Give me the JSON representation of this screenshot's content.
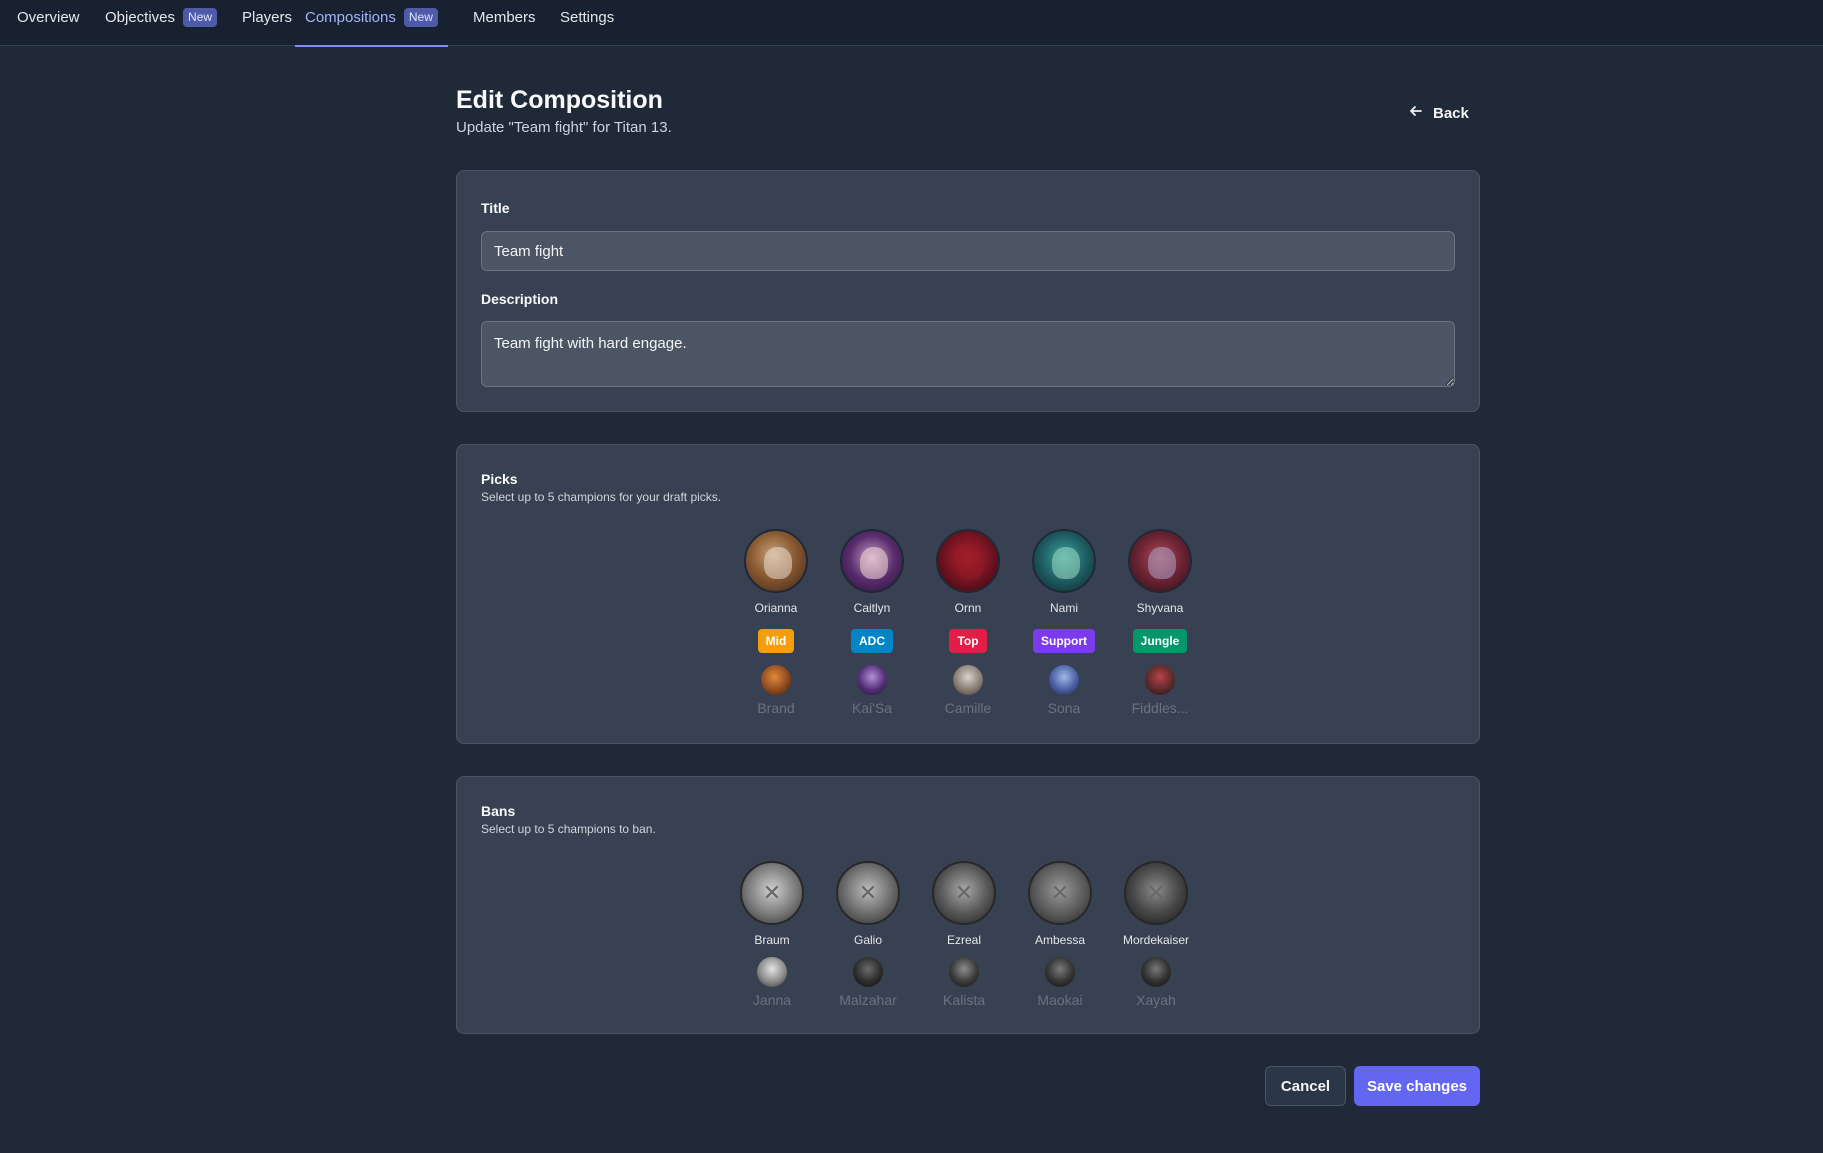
{
  "nav": {
    "tabs": [
      {
        "label": "Overview"
      },
      {
        "label": "Objectives",
        "badge": "New"
      },
      {
        "label": "Players"
      },
      {
        "label": "Compositions",
        "badge": "New"
      },
      {
        "label": "Members"
      },
      {
        "label": "Settings"
      }
    ],
    "active_tab": "Compositions"
  },
  "header": {
    "title": "Edit Composition",
    "subtitle": "Update \"Team fight\" for Titan 13.",
    "back_label": "Back"
  },
  "form": {
    "title_label": "Title",
    "title_value": "Team fight",
    "description_label": "Description",
    "description_value": "Team fight with hard engage."
  },
  "picks": {
    "title": "Picks",
    "subtitle": "Select up to 5 champions for your draft picks.",
    "items": [
      {
        "name": "Orianna",
        "role": "Mid",
        "alt": "Brand"
      },
      {
        "name": "Caitlyn",
        "role": "ADC",
        "alt": "Kai'Sa"
      },
      {
        "name": "Ornn",
        "role": "Top",
        "alt": "Camille"
      },
      {
        "name": "Nami",
        "role": "Support",
        "alt": "Sona"
      },
      {
        "name": "Shyvana",
        "role": "Jungle",
        "alt": "Fiddles..."
      }
    ]
  },
  "bans": {
    "title": "Bans",
    "subtitle": "Select up to 5 champions to ban.",
    "items": [
      {
        "name": "Braum",
        "alt": "Janna"
      },
      {
        "name": "Galio",
        "alt": "Malzahar"
      },
      {
        "name": "Ezreal",
        "alt": "Kalista"
      },
      {
        "name": "Ambessa",
        "alt": "Maokai"
      },
      {
        "name": "Mordekaiser",
        "alt": "Xayah"
      }
    ]
  },
  "actions": {
    "cancel_label": "Cancel",
    "save_label": "Save changes"
  },
  "colors": {
    "accent": "#6366f1",
    "role_mid": "#f59e0b",
    "role_adc": "#0284c7",
    "role_top": "#e11d48",
    "role_support": "#7c3aed",
    "role_jungle": "#059669"
  }
}
